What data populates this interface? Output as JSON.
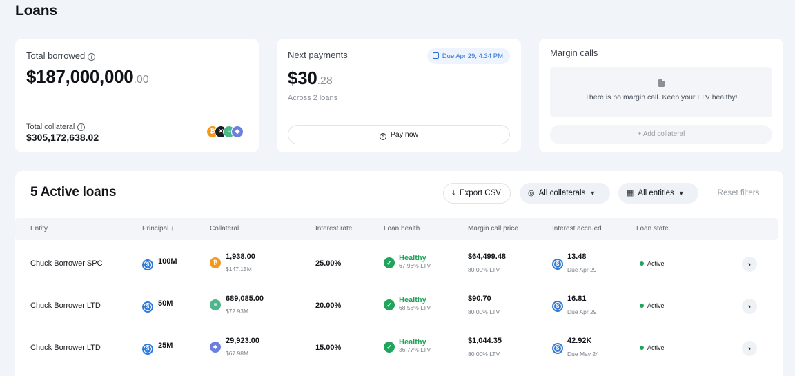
{
  "page": {
    "title": "Loans"
  },
  "total_borrowed": {
    "label": "Total borrowed",
    "amount": "$187,000,000",
    "cents": ".00",
    "collateral_label": "Total collateral",
    "collateral_amount": "$305,172,638.02"
  },
  "next_payments": {
    "label": "Next payments",
    "due": "Due Apr 29, 4:34 PM",
    "amount": "$30",
    "cents": ".28",
    "sub": "Across 2 loans",
    "pay_label": "Pay now"
  },
  "margin_calls": {
    "label": "Margin calls",
    "empty_text": "There is no margin call. Keep your LTV healthy!",
    "add_label": "+ Add collateral"
  },
  "loans": {
    "title": "5 Active loans",
    "export_label": "Export CSV",
    "collaterals_label": "All collaterals",
    "entities_label": "All entities",
    "reset_label": "Reset filters",
    "columns": {
      "entity": "Entity",
      "principal": "Principal ↓",
      "collateral": "Collateral",
      "rate": "Interest rate",
      "health": "Loan health",
      "mcp": "Margin call price",
      "accrued": "Interest accrued",
      "state": "Loan state"
    },
    "rows": [
      {
        "entity": "Chuck Borrower SPC",
        "principal": "100M",
        "collateral_amount": "1,938.00",
        "collateral_value": "$147.15M",
        "rate": "25.00%",
        "health": "Healthy",
        "ltv": "67.96% LTV",
        "mcp": "$64,499.48",
        "mcp_ltv": "80.00% LTV",
        "accrued": "13.48",
        "accrued_due": "Due Apr 29",
        "state": "Active"
      },
      {
        "entity": "Chuck Borrower LTD",
        "principal": "50M",
        "collateral_amount": "689,085.00",
        "collateral_value": "$72.93M",
        "rate": "20.00%",
        "health": "Healthy",
        "ltv": "68.56% LTV",
        "mcp": "$90.70",
        "mcp_ltv": "80.00% LTV",
        "accrued": "16.81",
        "accrued_due": "Due Apr 29",
        "state": "Active"
      },
      {
        "entity": "Chuck Borrower LTD",
        "principal": "25M",
        "collateral_amount": "29,923.00",
        "collateral_value": "$67.98M",
        "rate": "15.00%",
        "health": "Healthy",
        "ltv": "36.77% LTV",
        "mcp": "$1,044.35",
        "mcp_ltv": "80.00% LTV",
        "accrued": "42.92K",
        "accrued_due": "Due May 24",
        "state": "Active"
      }
    ]
  },
  "colors": {
    "accent_blue": "#2e6fd3",
    "healthy_green": "#22a45d",
    "usdc_blue": "#2f7bd9",
    "btc_orange": "#f39a1e",
    "sol_green": "#4fb58a",
    "eth_purple": "#6b7fe0"
  },
  "icons": {
    "collateral_row_icons": [
      "bitcoin-icon",
      "solana-icon",
      "ethereum-icon"
    ]
  }
}
